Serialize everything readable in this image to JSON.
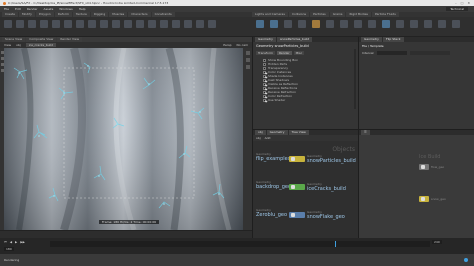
{
  "window": {
    "title": "C:/Users/SA/FX - C:/Desktop/Ice_Pt/snowEffect/SFX_v04.hipnc - Houdini Indie Limited-Commercial 17.5.173"
  },
  "menu": {
    "items": [
      "File",
      "Edit",
      "Render",
      "Assets",
      "Windows",
      "Help"
    ],
    "desktop": "Technical"
  },
  "shelf": {
    "tabs": [
      "Create",
      "Modify",
      "Polygon",
      "Deform",
      "Texture",
      "Rigging",
      "Muscles",
      "Characters",
      "Constraints"
    ],
    "tabs_right": [
      "Lights and Cameras",
      "Collisions",
      "Particles",
      "Grains",
      "Rigid Bodies",
      "Particle Fluids"
    ]
  },
  "viewport": {
    "tabs": [
      "Scene View",
      "Composite View",
      "Render View"
    ],
    "toolbar_items": [
      "View",
      "obj",
      "ice_cracks_build",
      "Persp",
      "No cam"
    ],
    "readout": "Frame: 180  Hi/Vis: 2  Time: 00:00:06"
  },
  "param": {
    "tabs": [
      "Geometry",
      "snowParticles_build"
    ],
    "header": "Geometry  snowParticles_build",
    "fields": [
      "Transform",
      "Render",
      "Misc"
    ],
    "items": [
      {
        "label": "Show Bounding Box",
        "on": false
      },
      {
        "label": "Hidden Parts",
        "on": false
      },
      {
        "label": "Transparency",
        "on": false
      },
      {
        "label": "Color Instances",
        "on": true
      },
      {
        "label": "Shade Instances",
        "on": true
      },
      {
        "label": "Cast Shadows",
        "on": true
      },
      {
        "label": "Visible as Reflection",
        "on": true
      },
      {
        "label": "Receive Reflections",
        "on": true
      },
      {
        "label": "Receive Refraction",
        "on": true
      },
      {
        "label": "Color Refraction",
        "on": true
      },
      {
        "label": "Use Shader",
        "on": true
      }
    ]
  },
  "param2": {
    "tabs": [
      "Geometry",
      "Flip Stack"
    ],
    "header": "File / Template",
    "label": "Interval"
  },
  "network": {
    "tabs": [
      "obj",
      "Geometry",
      "Tree View"
    ],
    "path": "obj",
    "context": "Objects",
    "nodes": [
      {
        "type": "Geometry",
        "name": "flip_examples",
        "output": "snowParticles_build",
        "color": "y"
      },
      {
        "type": "Geometry",
        "name": "backdrop_geo",
        "output": "iceCracks_build",
        "color": "g"
      },
      {
        "type": "Geometry",
        "name": "Zeroblu_geo",
        "output": "snowFlake_geo",
        "color": "b"
      }
    ]
  },
  "network2": {
    "label": "Ice Build",
    "nodes": [
      "flow_geo",
      "snow_geo"
    ]
  },
  "timeline": {
    "frame": "180",
    "end": "240",
    "ticks": [
      "24",
      "48",
      "72",
      "96",
      "120",
      "144",
      "168",
      "192",
      "216"
    ]
  },
  "status": {
    "text": "Rendering"
  },
  "colors": {
    "accent": "#3fa0e0",
    "node_yellow": "#c7b33c",
    "node_green": "#5aa84a",
    "node_blue": "#5a7eaa"
  }
}
